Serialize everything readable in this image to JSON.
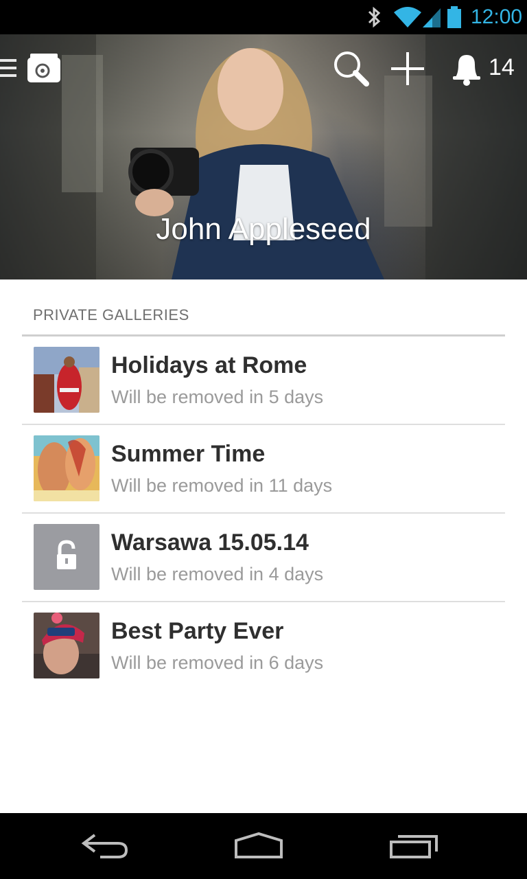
{
  "status_bar": {
    "time": "12:00",
    "accent_color": "#33b5e5",
    "icons": [
      "bluetooth-icon",
      "wifi-icon",
      "signal-icon",
      "battery-icon"
    ]
  },
  "toolbar": {
    "icons": [
      "menu-icon",
      "app-logo-icon",
      "search-icon",
      "add-icon",
      "bell-icon"
    ],
    "notification_count": "14"
  },
  "profile": {
    "name": "John Appleseed"
  },
  "galleries": {
    "section_title": "PRIVATE GALLERIES",
    "items": [
      {
        "title": "Holidays at Rome",
        "subtitle": "Will be removed in 5 days",
        "thumbnail": "photo"
      },
      {
        "title": "Summer Time",
        "subtitle": "Will be removed in 11 days",
        "thumbnail": "photo"
      },
      {
        "title": "Warsawa 15.05.14",
        "subtitle": "Will be removed in 4 days",
        "thumbnail": "lock-icon"
      },
      {
        "title": "Best Party Ever",
        "subtitle": "Will be removed in 6 days",
        "thumbnail": "photo"
      }
    ]
  },
  "nav_bar": {
    "icons": [
      "back-icon",
      "home-icon",
      "recents-icon"
    ]
  }
}
